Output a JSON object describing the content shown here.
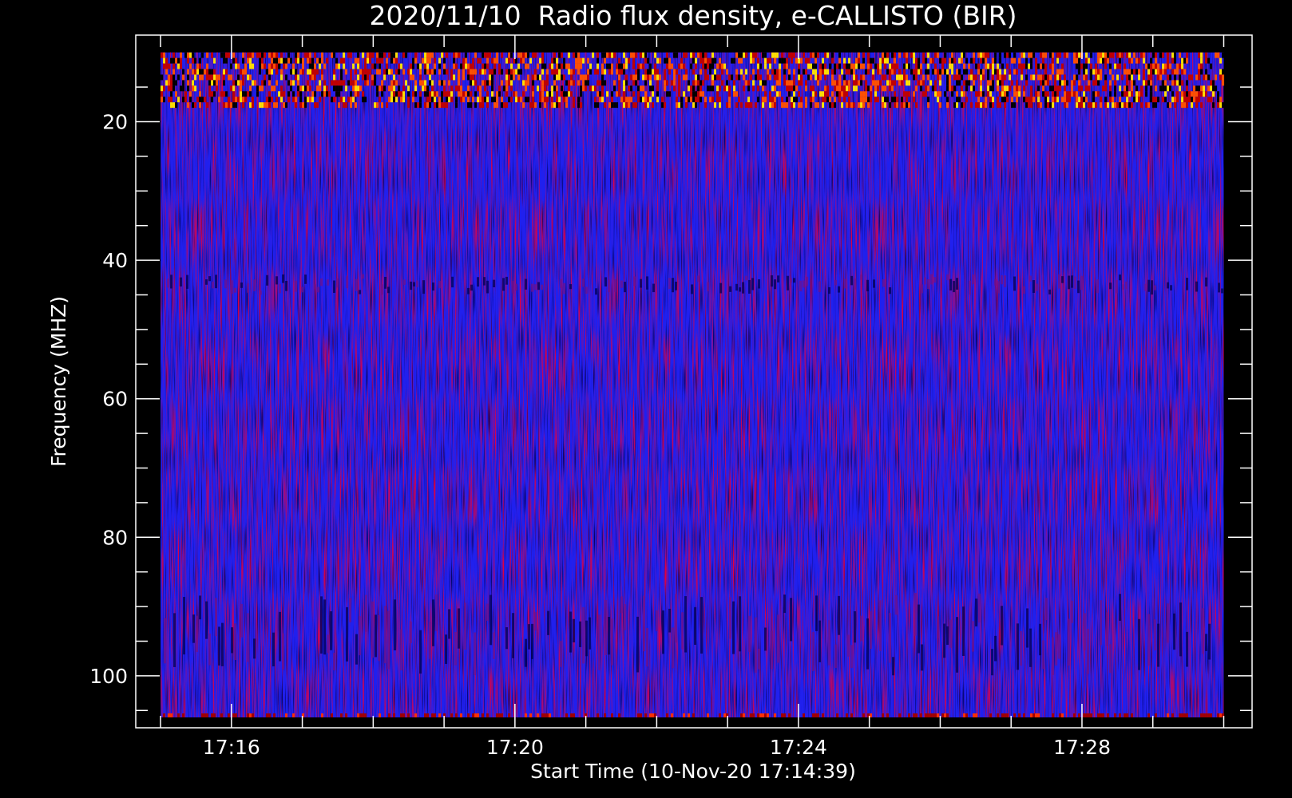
{
  "chart_data": {
    "type": "heatmap",
    "title": "2020/11/10  Radio flux density, e-CALLISTO (BIR)",
    "xlabel": "Start Time (10-Nov-20 17:14:39)",
    "ylabel": "Frequency (MHZ)",
    "x_range": [
      "17:14:39",
      "17:30:24"
    ],
    "data_x_range": [
      "17:15:00",
      "17:30:00"
    ],
    "x_ticks": [
      "17:16",
      "17:20",
      "17:24",
      "17:28"
    ],
    "ylim": [
      107.5,
      7.5
    ],
    "data_y_range": [
      10,
      106
    ],
    "y_ticks": [
      20,
      40,
      60,
      80,
      100
    ],
    "y_inverted": true,
    "colormap": "blue-red-yellow",
    "background_color": "#000000",
    "dominant_color": "#2020ee",
    "bright_bands_mhz": [
      [
        10,
        18
      ]
    ],
    "dark_bands_mhz": [
      [
        42,
        45
      ],
      [
        88,
        100
      ]
    ]
  }
}
